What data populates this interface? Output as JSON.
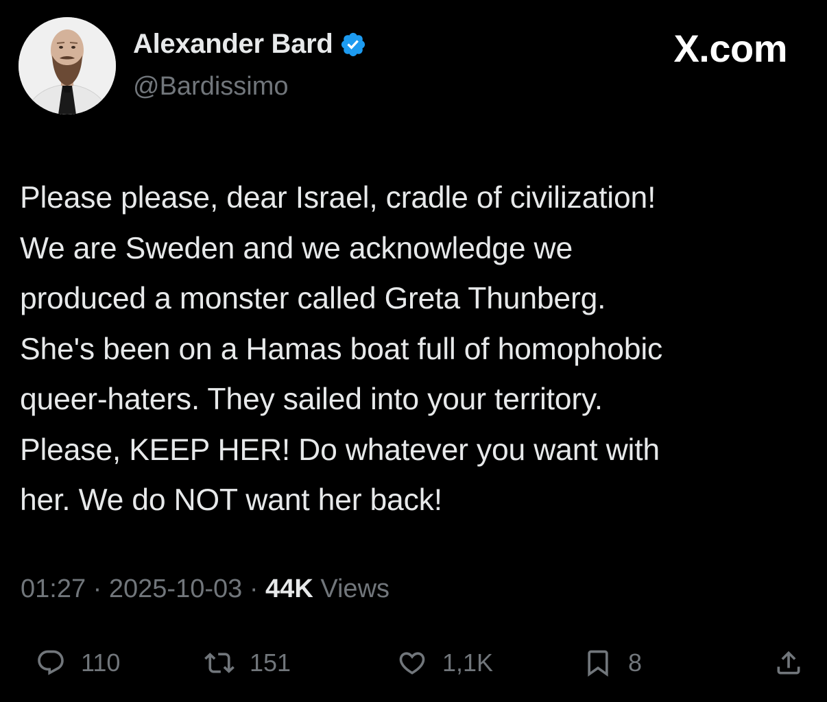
{
  "author": {
    "display_name": "Alexander Bard",
    "handle": "@Bardissimo",
    "verified_color": "#1d9bf0"
  },
  "brand": {
    "label": "X.com"
  },
  "tweet": {
    "text": "Please please, dear Israel, cradle of civilization!\nWe are Sweden and we acknowledge we\nproduced a monster called Greta Thunberg.\nShe's been on a Hamas boat full of homophobic\nqueer-haters. They sailed into your territory.\nPlease, KEEP HER! Do whatever you want with\nher. We do NOT want her back!",
    "time": "01:27",
    "date": "2025-10-03",
    "separator": "·",
    "views_count": "44K",
    "views_label": "Views"
  },
  "actions": {
    "replies": {
      "icon": "reply-icon",
      "count": "110"
    },
    "reposts": {
      "icon": "repost-icon",
      "count": "151"
    },
    "likes": {
      "icon": "heart-icon",
      "count": "1,1K"
    },
    "bookmarks": {
      "icon": "bookmark-icon",
      "count": "8"
    },
    "share": {
      "icon": "share-icon"
    }
  },
  "colors": {
    "background": "#000000",
    "text": "#e7e9ea",
    "muted": "#71767b",
    "accent": "#1d9bf0"
  }
}
